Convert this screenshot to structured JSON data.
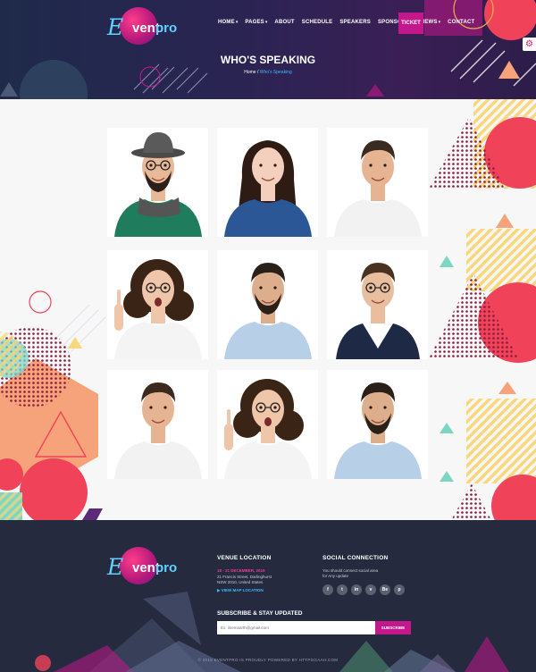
{
  "header": {
    "logo_text": "eventpro",
    "nav": [
      "HOME",
      "PAGES",
      "ABOUT",
      "SCHEDULE",
      "SPEAKERS",
      "SPONSORES",
      "NEWS",
      "CONTACT"
    ],
    "nav_dropdown": [
      true,
      true,
      false,
      false,
      false,
      false,
      true,
      false
    ],
    "ticket_label": "TICKET",
    "page_title": "WHO'S SPEAKING",
    "breadcrumb": {
      "home": "Home",
      "sep": "/",
      "current": "Who's Speaking"
    }
  },
  "speakers": [
    {
      "shirt": "#1f7d5d",
      "hair": "#2a1f1a",
      "hat": true,
      "beard": true,
      "glasses": true,
      "scarf": true,
      "skin": "#e7b999"
    },
    {
      "shirt": "#2b5797",
      "hair": "#2d1b14",
      "long_hair": true,
      "skin": "#f3d0be"
    },
    {
      "shirt": "#f2f2f2",
      "hair": "#3b2a1f",
      "skin": "#e6b393"
    },
    {
      "shirt": "#f4f4f4",
      "hair": "#3a2416",
      "curly": true,
      "glasses": true,
      "pointing": true,
      "skin": "#f0c6aa"
    },
    {
      "shirt": "#b8cfe8",
      "hair": "#2b2018",
      "beard": true,
      "skin": "#dcae8c"
    },
    {
      "shirt": "#1e2a45",
      "hair": "#4a3222",
      "glasses": true,
      "suit": true,
      "skin": "#e8be9f"
    },
    {
      "shirt": "#f2f2f2",
      "hair": "#3b2a1f",
      "skin": "#e6b393"
    },
    {
      "shirt": "#f4f4f4",
      "hair": "#3a2416",
      "curly": true,
      "glasses": true,
      "pointing": true,
      "skin": "#f0c6aa"
    },
    {
      "shirt": "#b8cfe8",
      "hair": "#2b2018",
      "beard": true,
      "skin": "#dcae8c"
    }
  ],
  "footer": {
    "venue_title": "VENUE LOCATION",
    "venue_date": "18 - 21 DECEMBER, 2019",
    "venue_address_1": "21 Francis Street, Darlinghurst",
    "venue_address_2": "NSW 2010, United States",
    "venue_map_link": "▶ VIEW MAP LOCATION",
    "social_title": "SOCIAL CONNECTION",
    "social_text_1": "You should connect social area",
    "social_text_2": "for Any update",
    "social_icons": [
      "f",
      "t",
      "in",
      "v",
      "Be",
      "p"
    ],
    "subscribe_title": "SUBSCRIBE & STAY UPDATED",
    "subscribe_placeholder": "Ex: ilnemaarth@gmail.com",
    "subscribe_button": "SUBSCRIBE",
    "copyright": "© 2015 EVENTPRO IS PROUDLY POWERED BY HTTPGGAAH.COM"
  },
  "colors": {
    "accent_pink": "#c2188b",
    "link_blue": "#3fb8ff",
    "coral": "#f0435a",
    "yellow": "#f9d77a",
    "teal": "#7dd6c4",
    "peach": "#f6a27a"
  }
}
